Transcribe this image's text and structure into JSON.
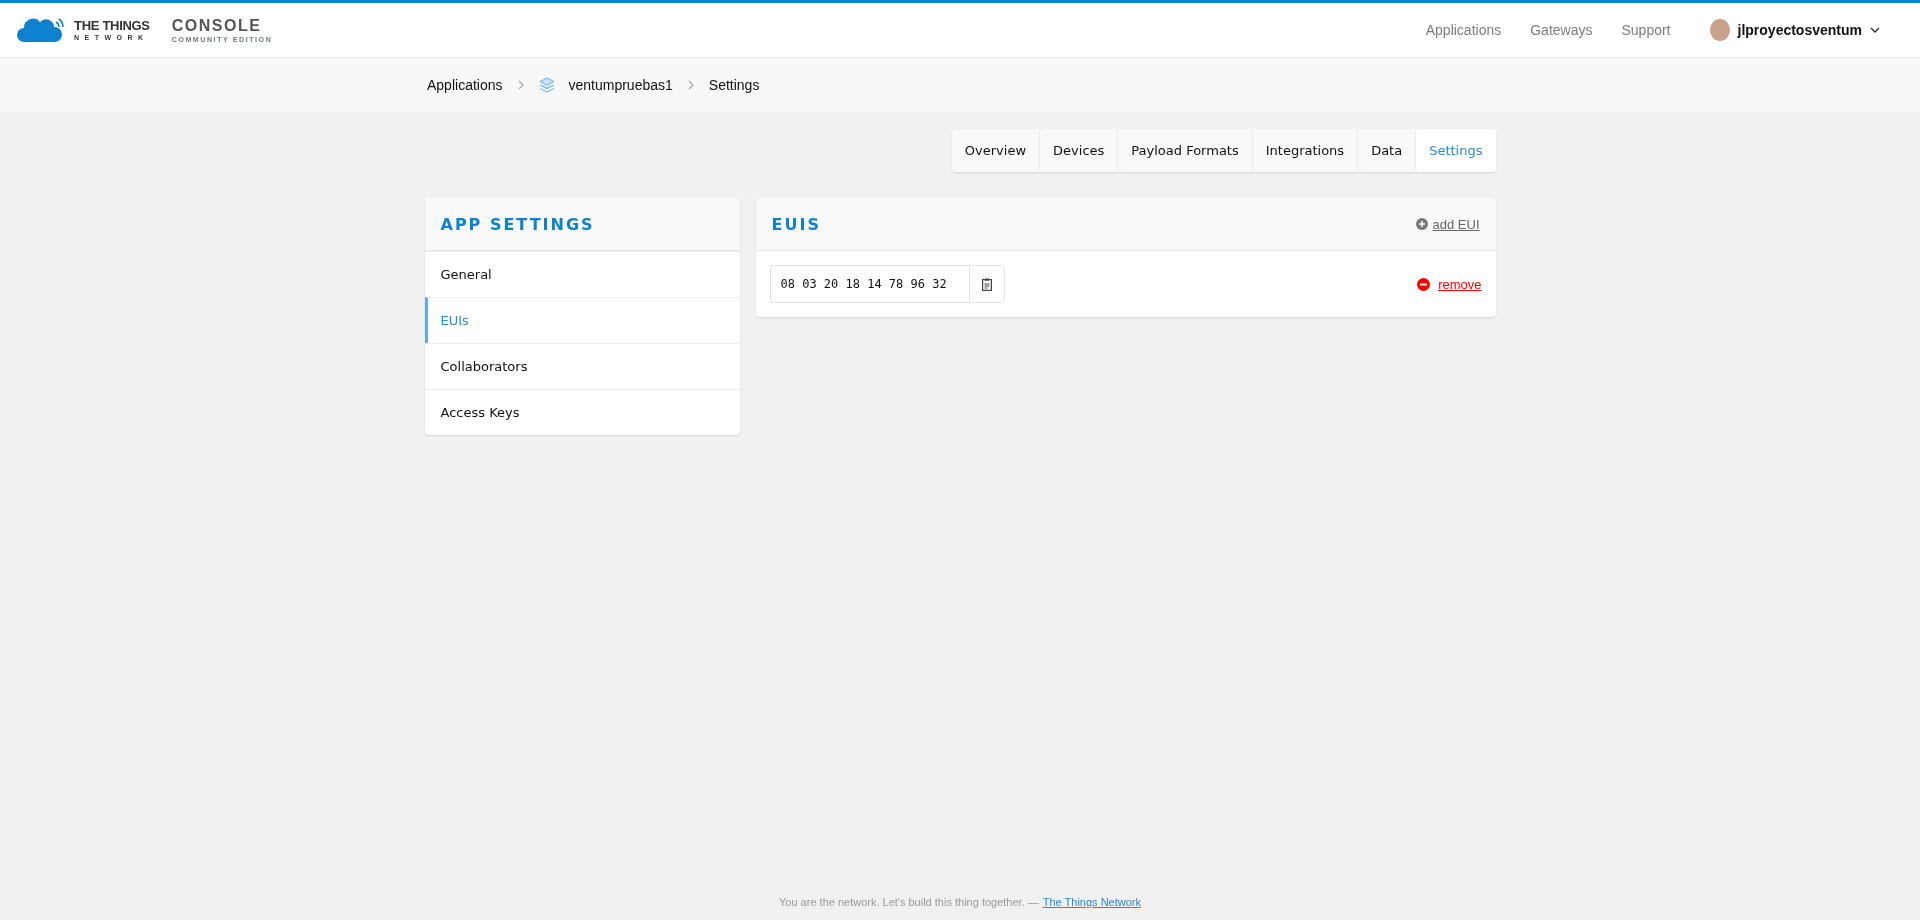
{
  "brand": {
    "name": "THE THINGS",
    "sub": "NETWORK",
    "product": "CONSOLE",
    "edition": "COMMUNITY EDITION"
  },
  "nav": [
    "Applications",
    "Gateways",
    "Support"
  ],
  "user": {
    "name": "jlproyectosventum"
  },
  "breadcrumb": [
    "Applications",
    "ventumpruebas1",
    "Settings"
  ],
  "tabs": [
    {
      "label": "Overview",
      "selected": false
    },
    {
      "label": "Devices",
      "selected": false
    },
    {
      "label": "Payload Formats",
      "selected": false
    },
    {
      "label": "Integrations",
      "selected": false
    },
    {
      "label": "Data",
      "selected": false
    },
    {
      "label": "Settings",
      "selected": true
    }
  ],
  "sidebar": {
    "title": "APP SETTINGS",
    "items": [
      {
        "label": "General",
        "selected": false
      },
      {
        "label": "EUIs",
        "selected": true
      },
      {
        "label": "Collaborators",
        "selected": false
      },
      {
        "label": "Access Keys",
        "selected": false
      }
    ]
  },
  "euis": {
    "title": "EUIS",
    "add": "add EUI",
    "items": [
      {
        "value": "08 03 20 18 14 78 96 32",
        "action": "remove"
      }
    ]
  },
  "footer": {
    "text": "You are the network. Let's build this thing together. —",
    "link": "The Things Network"
  }
}
